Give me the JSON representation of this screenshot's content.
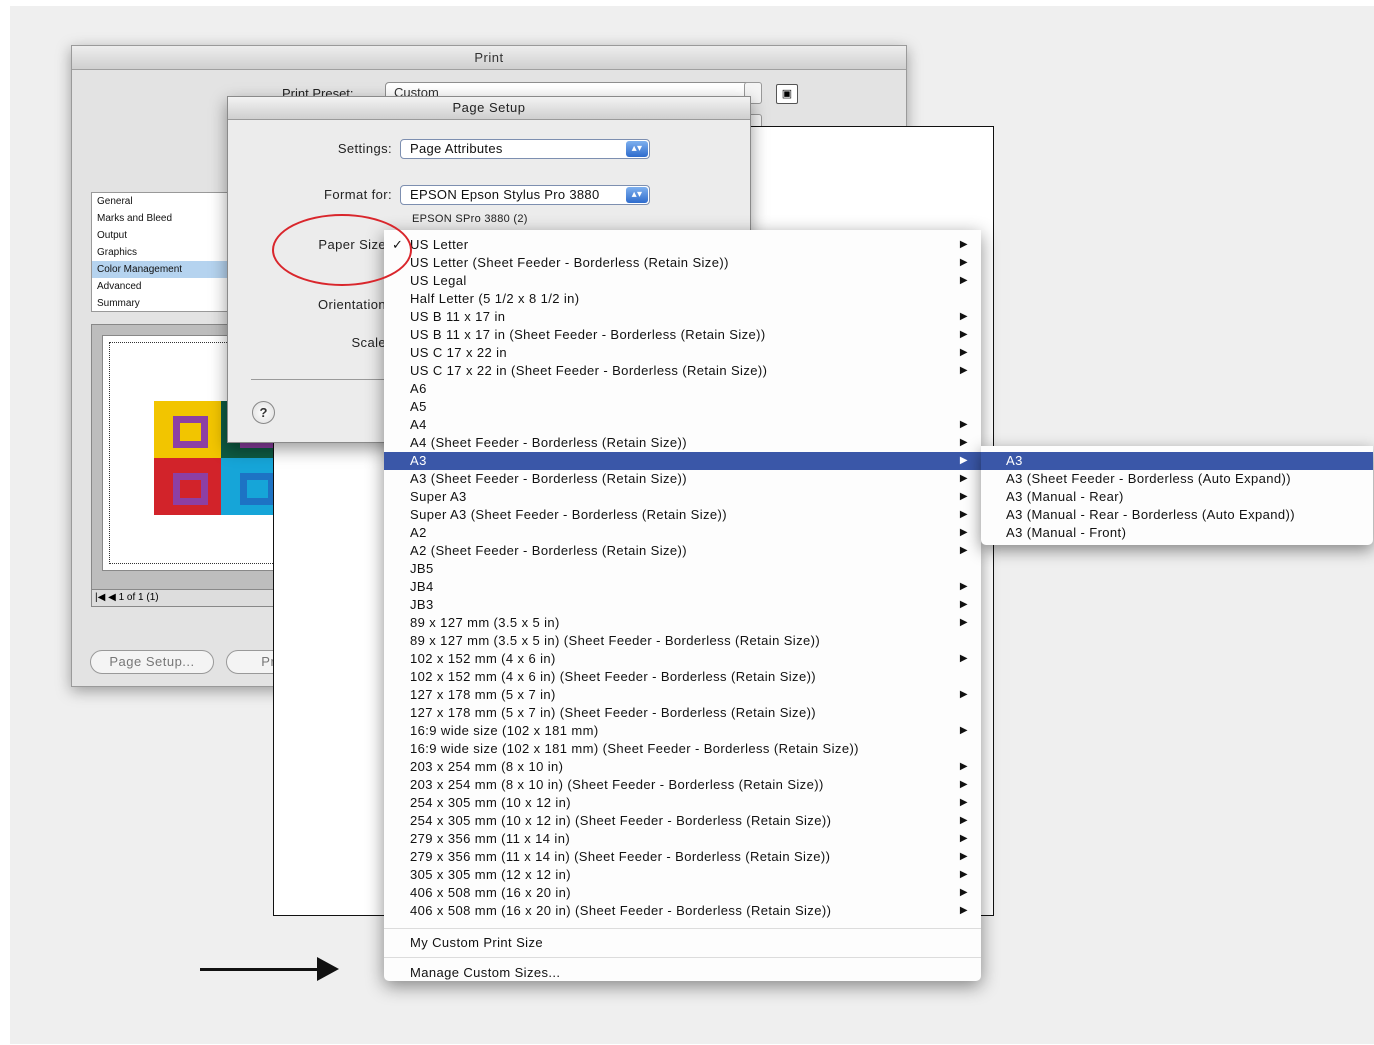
{
  "print_dialog": {
    "title": "Print",
    "print_preset_label": "Print Preset:",
    "print_preset_value": "Custom",
    "categories": [
      "General",
      "Marks and Bleed",
      "Output",
      "Graphics",
      "Color Management",
      "Advanced",
      "Summary"
    ],
    "selected_category": "Color Management",
    "pager_text": "1 of 1 (1)",
    "page_setup_button": "Page Setup...",
    "printer_button": "Printer..."
  },
  "page_setup": {
    "title": "Page Setup",
    "settings_label": "Settings:",
    "settings_value": "Page Attributes",
    "format_label": "Format for:",
    "format_value": "EPSON Epson Stylus Pro 3880",
    "format_sub": "EPSON SPro 3880 (2)",
    "paper_size_label": "Paper Size",
    "orientation_label": "Orientation",
    "scale_label": "Scale",
    "help_symbol": "?"
  },
  "paper_menu": {
    "items": [
      {
        "label": "US Letter",
        "checked": true,
        "submenu": true
      },
      {
        "label": "US Letter (Sheet Feeder - Borderless (Retain Size))",
        "submenu": true
      },
      {
        "label": "US Legal",
        "submenu": true
      },
      {
        "label": "Half Letter (5 1/2 x 8 1/2 in)",
        "submenu": false
      },
      {
        "label": "US B 11 x 17 in",
        "submenu": true
      },
      {
        "label": "US B 11 x 17 in (Sheet Feeder - Borderless (Retain Size))",
        "submenu": true
      },
      {
        "label": "US C 17 x 22 in",
        "submenu": true
      },
      {
        "label": "US C 17 x 22 in (Sheet Feeder - Borderless (Retain Size))",
        "submenu": true
      },
      {
        "label": "A6",
        "submenu": false
      },
      {
        "label": "A5",
        "submenu": false
      },
      {
        "label": "A4",
        "submenu": true
      },
      {
        "label": "A4 (Sheet Feeder - Borderless (Retain Size))",
        "submenu": true
      },
      {
        "label": "A3",
        "submenu": true,
        "highlighted": true
      },
      {
        "label": "A3 (Sheet Feeder - Borderless (Retain Size))",
        "submenu": true
      },
      {
        "label": "Super A3",
        "submenu": true
      },
      {
        "label": "Super A3 (Sheet Feeder - Borderless (Retain Size))",
        "submenu": true
      },
      {
        "label": "A2",
        "submenu": true
      },
      {
        "label": "A2 (Sheet Feeder - Borderless (Retain Size))",
        "submenu": true
      },
      {
        "label": "JB5",
        "submenu": false
      },
      {
        "label": "JB4",
        "submenu": true
      },
      {
        "label": "JB3",
        "submenu": true
      },
      {
        "label": "89 x 127 mm (3.5 x 5 in)",
        "submenu": true
      },
      {
        "label": "89 x 127 mm (3.5 x 5 in) (Sheet Feeder - Borderless (Retain Size))",
        "submenu": false
      },
      {
        "label": "102 x 152 mm (4 x 6 in)",
        "submenu": true
      },
      {
        "label": "102 x 152 mm (4 x 6 in) (Sheet Feeder - Borderless (Retain Size))",
        "submenu": false
      },
      {
        "label": "127 x 178 mm (5 x 7 in)",
        "submenu": true
      },
      {
        "label": "127 x 178 mm (5 x 7 in) (Sheet Feeder - Borderless (Retain Size))",
        "submenu": false
      },
      {
        "label": "16:9 wide size (102 x 181 mm)",
        "submenu": true
      },
      {
        "label": "16:9 wide size (102 x 181 mm) (Sheet Feeder - Borderless (Retain Size))",
        "submenu": false
      },
      {
        "label": "203 x 254 mm (8 x 10 in)",
        "submenu": true
      },
      {
        "label": "203 x 254 mm (8 x 10 in) (Sheet Feeder - Borderless (Retain Size))",
        "submenu": true
      },
      {
        "label": "254 x 305 mm (10 x 12 in)",
        "submenu": true
      },
      {
        "label": "254 x 305 mm (10 x 12 in) (Sheet Feeder - Borderless (Retain Size))",
        "submenu": true
      },
      {
        "label": "279 x 356 mm (11 x 14 in)",
        "submenu": true
      },
      {
        "label": "279 x 356 mm (11 x 14 in) (Sheet Feeder - Borderless (Retain Size))",
        "submenu": true
      },
      {
        "label": "305 x 305 mm (12 x 12 in)",
        "submenu": true
      },
      {
        "label": "406 x 508 mm (16 x 20 in)",
        "submenu": true
      },
      {
        "label": "406 x 508 mm (16 x 20 in) (Sheet Feeder - Borderless (Retain Size))",
        "submenu": true
      }
    ],
    "custom_item": "My Custom Print Size",
    "manage_item": "Manage Custom Sizes..."
  },
  "a3_submenu": {
    "items": [
      {
        "label": "A3",
        "highlighted": true
      },
      {
        "label": "A3 (Sheet Feeder - Borderless (Auto Expand))"
      },
      {
        "label": "A3 (Manual - Rear)"
      },
      {
        "label": "A3 (Manual - Rear - Borderless (Auto Expand))"
      },
      {
        "label": "A3 (Manual - Front)"
      }
    ]
  },
  "colors": {
    "highlight": "#3a57a8",
    "annotation_red": "#d9262c"
  },
  "icons": {
    "checkmark": "✓",
    "submenu_arrow": "▶",
    "save": "floppy-disk-icon"
  }
}
